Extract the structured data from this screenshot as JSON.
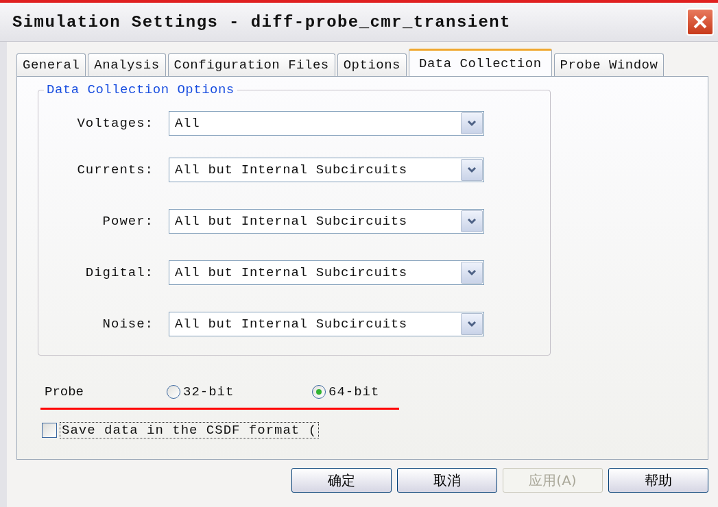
{
  "window": {
    "title": "Simulation Settings - diff-probe_cmr_transient"
  },
  "tabs": [
    {
      "label": "General",
      "selected": false
    },
    {
      "label": "Analysis",
      "selected": false
    },
    {
      "label": "Configuration Files",
      "selected": false
    },
    {
      "label": "Options",
      "selected": false
    },
    {
      "label": "Data Collection",
      "selected": true
    },
    {
      "label": "Probe Window",
      "selected": false
    }
  ],
  "group": {
    "title": "Data Collection Options",
    "fields": [
      {
        "label": "Voltages:",
        "value": "All"
      },
      {
        "label": "Currents:",
        "value": "All but Internal Subcircuits"
      },
      {
        "label": "Power:",
        "value": "All but Internal Subcircuits"
      },
      {
        "label": "Digital:",
        "value": "All but Internal Subcircuits"
      },
      {
        "label": "Noise:",
        "value": "All but Internal Subcircuits"
      }
    ]
  },
  "probe": {
    "label": "Probe",
    "options": [
      {
        "label": "32-bit",
        "selected": false
      },
      {
        "label": "64-bit",
        "selected": true
      }
    ]
  },
  "csdf": {
    "label": "Save data in the CSDF format (",
    "checked": false
  },
  "buttons": [
    {
      "label": "确定",
      "disabled": false
    },
    {
      "label": "取消",
      "disabled": false
    },
    {
      "label": "应用(A)",
      "disabled": true
    },
    {
      "label": "帮助",
      "disabled": false
    }
  ]
}
